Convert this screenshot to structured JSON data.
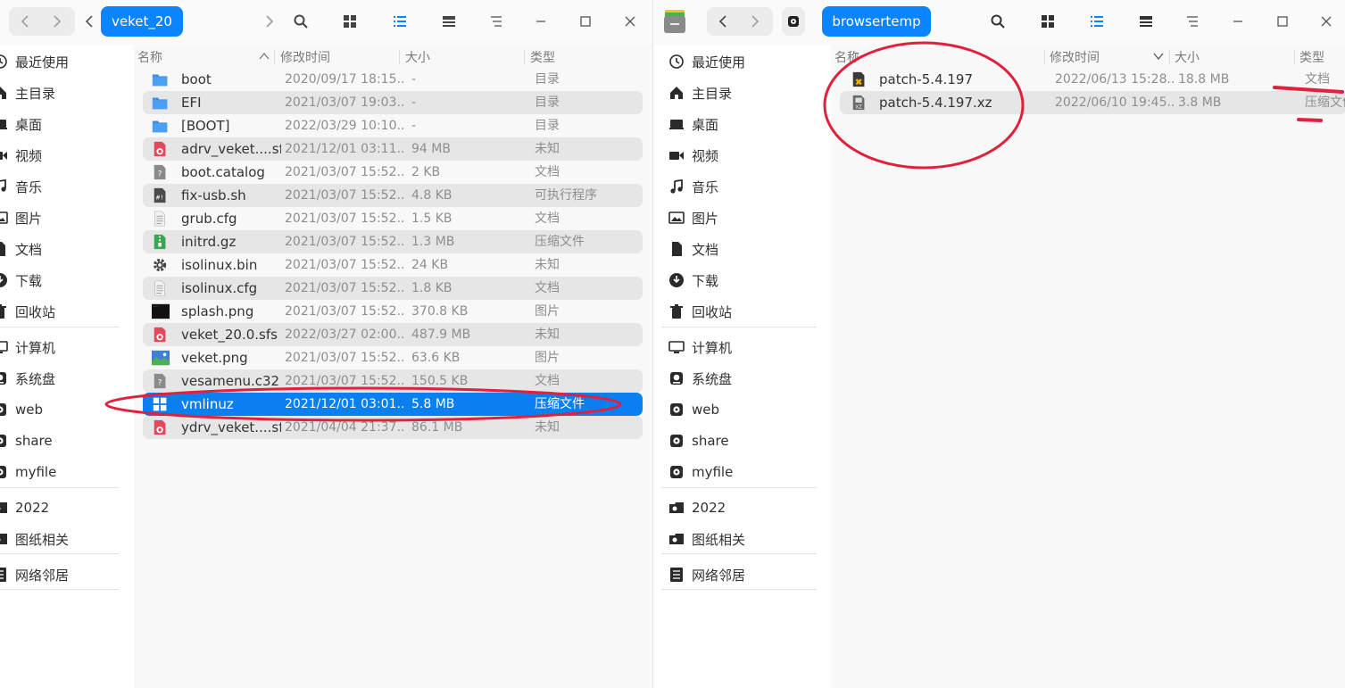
{
  "left": {
    "breadcrumb": "veket_20",
    "columns": {
      "name": "名称",
      "modified": "修改时间",
      "size": "大小",
      "type": "类型"
    },
    "sidebar": [
      {
        "label": "最近使用",
        "icon": "clock-icon"
      },
      {
        "label": "主目录",
        "icon": "home-icon"
      },
      {
        "label": "桌面",
        "icon": "desktop-icon"
      },
      {
        "label": "视频",
        "icon": "video-icon"
      },
      {
        "label": "音乐",
        "icon": "music-icon"
      },
      {
        "label": "图片",
        "icon": "picture-icon"
      },
      {
        "label": "文档",
        "icon": "document-icon"
      },
      {
        "label": "下载",
        "icon": "download-icon"
      },
      {
        "label": "回收站",
        "icon": "trash-icon"
      },
      {
        "label": "计算机",
        "icon": "computer-icon"
      },
      {
        "label": "系统盘",
        "icon": "disk-icon"
      },
      {
        "label": "web",
        "icon": "drive-icon"
      },
      {
        "label": "share",
        "icon": "drive-icon"
      },
      {
        "label": "myfile",
        "icon": "drive-icon"
      },
      {
        "label": "2022",
        "icon": "folder-tag-icon"
      },
      {
        "label": "图纸相关",
        "icon": "folder-tag-icon"
      },
      {
        "label": "网络邻居",
        "icon": "network-icon"
      }
    ],
    "files": [
      {
        "name": "boot",
        "modified": "2020/09/17 18:15...",
        "size": "-",
        "type": "目录",
        "icon": "folder-icon"
      },
      {
        "name": "EFI",
        "modified": "2021/03/07 19:03...",
        "size": "-",
        "type": "目录",
        "icon": "folder-icon"
      },
      {
        "name": "[BOOT]",
        "modified": "2022/03/29 10:10...",
        "size": "-",
        "type": "目录",
        "icon": "folder-icon"
      },
      {
        "name": "adrv_veket....sfs",
        "modified": "2021/12/01 03:11...",
        "size": "94 MB",
        "type": "未知",
        "icon": "unknown-file-icon"
      },
      {
        "name": "boot.catalog",
        "modified": "2021/03/07 15:52...",
        "size": "2 KB",
        "type": "文档",
        "icon": "question-file-icon"
      },
      {
        "name": "fix-usb.sh",
        "modified": "2021/03/07 15:52...",
        "size": "4.8 KB",
        "type": "可执行程序",
        "icon": "script-file-icon"
      },
      {
        "name": "grub.cfg",
        "modified": "2021/03/07 15:52...",
        "size": "1.5 KB",
        "type": "文档",
        "icon": "text-file-icon"
      },
      {
        "name": "initrd.gz",
        "modified": "2021/03/07 15:52...",
        "size": "1.3 MB",
        "type": "压缩文件",
        "icon": "archive-file-icon"
      },
      {
        "name": "isolinux.bin",
        "modified": "2021/03/07 15:52...",
        "size": "24 KB",
        "type": "未知",
        "icon": "gear-icon"
      },
      {
        "name": "isolinux.cfg",
        "modified": "2021/03/07 15:52...",
        "size": "1.8 KB",
        "type": "文档",
        "icon": "text-file-icon"
      },
      {
        "name": "splash.png",
        "modified": "2021/03/07 15:52...",
        "size": "370.8 KB",
        "type": "图片",
        "icon": "dark-image-icon"
      },
      {
        "name": "veket_20.0.sfs",
        "modified": "2022/03/27 02:00...",
        "size": "487.9 MB",
        "type": "未知",
        "icon": "unknown-file-icon"
      },
      {
        "name": "veket.png",
        "modified": "2021/03/07 15:52...",
        "size": "63.6 KB",
        "type": "图片",
        "icon": "landscape-image-icon"
      },
      {
        "name": "vesamenu.c32",
        "modified": "2021/03/07 15:52...",
        "size": "150.5 KB",
        "type": "文档",
        "icon": "question-file-icon"
      },
      {
        "name": "vmlinuz",
        "modified": "2021/12/01 03:01...",
        "size": "5.8 MB",
        "type": "压缩文件",
        "icon": "windows-icon",
        "selected": true
      },
      {
        "name": "ydrv_veket....sfs",
        "modified": "2021/04/04 21:37...",
        "size": "86.1 MB",
        "type": "未知",
        "icon": "unknown-file-icon"
      }
    ]
  },
  "right": {
    "breadcrumb": "browsertemp",
    "columns": {
      "name": "名称",
      "modified": "修改时间",
      "size": "大小",
      "type": "类型"
    },
    "sidebar": [
      {
        "label": "最近使用",
        "icon": "clock-icon"
      },
      {
        "label": "主目录",
        "icon": "home-icon"
      },
      {
        "label": "桌面",
        "icon": "desktop-icon"
      },
      {
        "label": "视频",
        "icon": "video-icon"
      },
      {
        "label": "音乐",
        "icon": "music-icon"
      },
      {
        "label": "图片",
        "icon": "picture-icon"
      },
      {
        "label": "文档",
        "icon": "document-icon"
      },
      {
        "label": "下载",
        "icon": "download-icon"
      },
      {
        "label": "回收站",
        "icon": "trash-icon"
      },
      {
        "label": "计算机",
        "icon": "computer-icon"
      },
      {
        "label": "系统盘",
        "icon": "disk-icon"
      },
      {
        "label": "web",
        "icon": "drive-icon"
      },
      {
        "label": "share",
        "icon": "drive-icon"
      },
      {
        "label": "myfile",
        "icon": "drive-icon"
      },
      {
        "label": "2022",
        "icon": "folder-tag-icon"
      },
      {
        "label": "图纸相关",
        "icon": "folder-tag-icon"
      },
      {
        "label": "网络邻居",
        "icon": "network-icon"
      }
    ],
    "files": [
      {
        "name": "patch-5.4.197",
        "modified": "2022/06/13 15:28...",
        "size": "18.8 MB",
        "type": "文档",
        "icon": "patch-file-icon"
      },
      {
        "name": "patch-5.4.197.xz",
        "modified": "2022/06/10 19:45...",
        "size": "3.8 MB",
        "type": "压缩文件",
        "icon": "xz-archive-icon"
      }
    ]
  },
  "colors": {
    "accent": "#0a84ff",
    "selection": "#0a7ff0",
    "annotation": "#e0203c"
  }
}
